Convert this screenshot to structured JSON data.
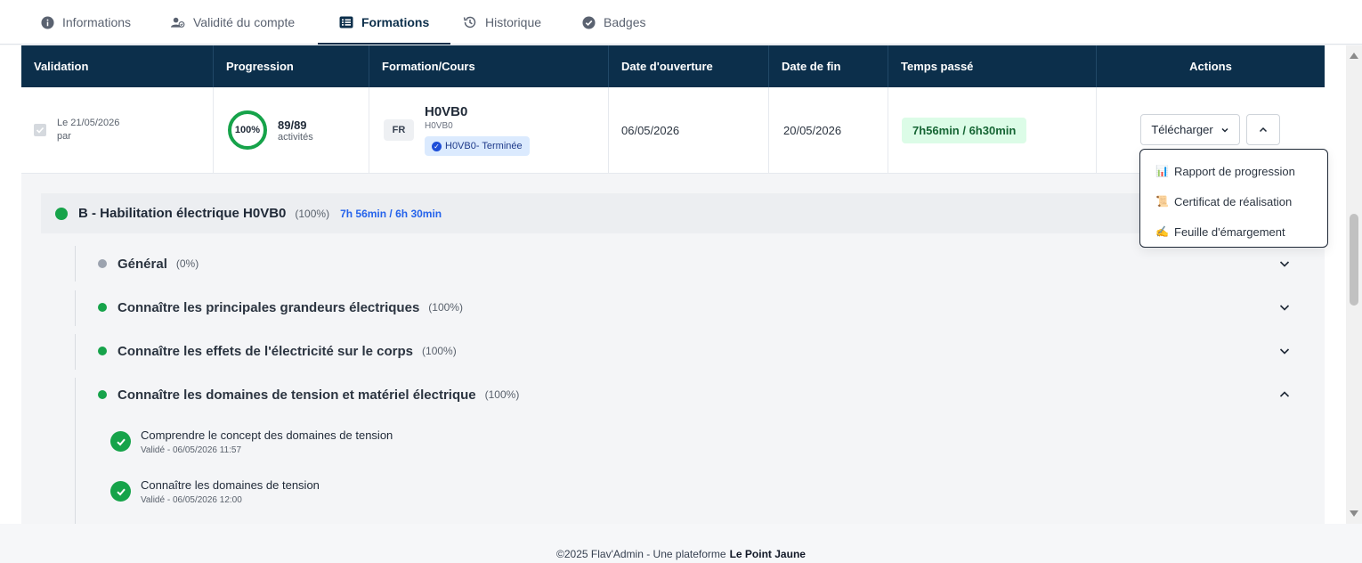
{
  "tabs": [
    {
      "label": "Informations",
      "icon": "info-icon"
    },
    {
      "label": "Validité du compte",
      "icon": "user-check-icon"
    },
    {
      "label": "Formations",
      "icon": "list-icon"
    },
    {
      "label": "Historique",
      "icon": "history-icon"
    },
    {
      "label": "Badges",
      "icon": "badge-check-icon"
    }
  ],
  "active_tab": "Formations",
  "table": {
    "headers": [
      "Validation",
      "Progression",
      "Formation/Cours",
      "Date d'ouverture",
      "Date de fin",
      "Temps passé",
      "Actions"
    ],
    "row": {
      "validation_date": "Le 21/05/2026",
      "validation_by": "par",
      "progress_pct": "100%",
      "progress_count": "89/89",
      "progress_unit": "activités",
      "lang": "FR",
      "course_title": "H0VB0",
      "course_code": "H0VB0",
      "course_status": "H0VB0- Terminée",
      "open_date": "06/05/2026",
      "end_date": "20/05/2026",
      "time_spent": "7h56min / 6h30min",
      "download_label": "Télécharger"
    }
  },
  "dropdown": [
    {
      "emoji": "📊",
      "label": "Rapport de progression"
    },
    {
      "emoji": "📜",
      "label": "Certificat de réalisation"
    },
    {
      "emoji": "✍️",
      "label": "Feuille d'émargement"
    }
  ],
  "module": {
    "title": "B - Habilitation électrique H0VB0",
    "pct": "(100%)",
    "time": "7h 56min / 6h 30min"
  },
  "sections": [
    {
      "title": "Général",
      "pct": "(0%)",
      "status": "grey"
    },
    {
      "title": "Connaître les principales grandeurs électriques",
      "pct": "(100%)",
      "status": "green"
    },
    {
      "title": "Connaître les effets de l'électricité sur le corps",
      "pct": "(100%)",
      "status": "green"
    },
    {
      "title": "Connaître les domaines de tension et matériel électrique",
      "pct": "(100%)",
      "status": "green"
    }
  ],
  "lessons": [
    {
      "title": "Comprendre le concept des domaines de tension",
      "sub": "Validé - 06/05/2026 11:57"
    },
    {
      "title": "Connaître les domaines de tension",
      "sub": "Validé - 06/05/2026 12:00"
    }
  ],
  "footer": {
    "text": "©2025 Flav'Admin - Une plateforme",
    "brand": "Le Point Jaune"
  },
  "colors": {
    "header_bg": "#0c2f4b",
    "success": "#16a34a",
    "accent_blue": "#2563eb"
  }
}
